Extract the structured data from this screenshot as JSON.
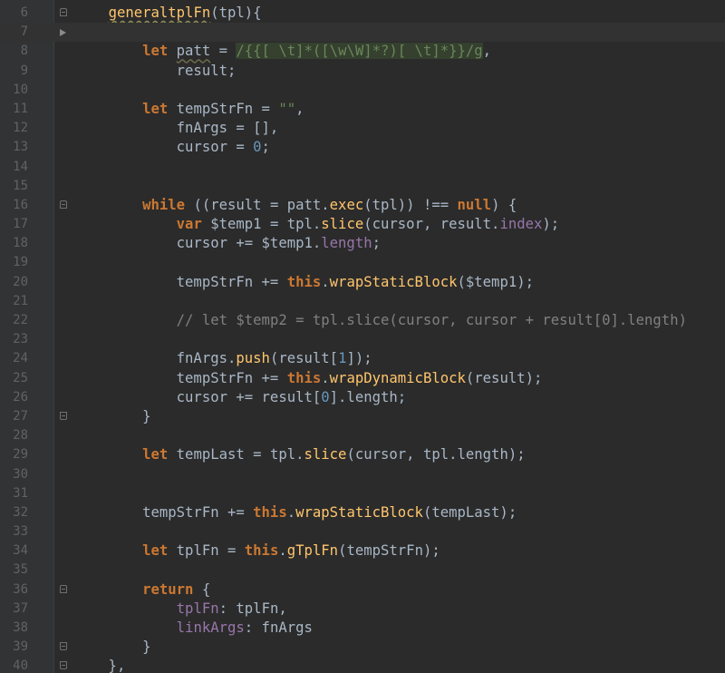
{
  "editor": {
    "lines": [
      {
        "n": "6",
        "fold": "open",
        "tokens": [
          {
            "t": "    "
          },
          {
            "t": "generaltplFn",
            "c": "fnu"
          },
          {
            "t": "(tpl){"
          }
        ]
      },
      {
        "n": "7",
        "current": true,
        "arrow": true,
        "tokens": []
      },
      {
        "n": "8",
        "tokens": [
          {
            "t": "        "
          },
          {
            "t": "let",
            "c": "kw"
          },
          {
            "t": " "
          },
          {
            "t": "patt",
            "c": "vwav"
          },
          {
            "t": " = "
          },
          {
            "t": "/{{[ \\t]*([\\w\\W]*?)[ \\t]*}}/g",
            "c": "rx"
          },
          {
            "t": ","
          }
        ]
      },
      {
        "n": "9",
        "tokens": [
          {
            "t": "            result;"
          }
        ]
      },
      {
        "n": "10",
        "tokens": []
      },
      {
        "n": "11",
        "tokens": [
          {
            "t": "        "
          },
          {
            "t": "let",
            "c": "kw"
          },
          {
            "t": " tempStrFn = "
          },
          {
            "t": "\"\"",
            "c": "str"
          },
          {
            "t": ","
          }
        ]
      },
      {
        "n": "12",
        "tokens": [
          {
            "t": "            fnArgs = [],"
          }
        ]
      },
      {
        "n": "13",
        "tokens": [
          {
            "t": "            cursor = "
          },
          {
            "t": "0",
            "c": "num"
          },
          {
            "t": ";"
          }
        ]
      },
      {
        "n": "14",
        "tokens": []
      },
      {
        "n": "15",
        "tokens": []
      },
      {
        "n": "16",
        "fold": "open",
        "tokens": [
          {
            "t": "        "
          },
          {
            "t": "while",
            "c": "kw"
          },
          {
            "t": " ((result = patt."
          },
          {
            "t": "exec",
            "c": "fn"
          },
          {
            "t": "(tpl)) !== "
          },
          {
            "t": "null",
            "c": "kw"
          },
          {
            "t": ") {"
          }
        ]
      },
      {
        "n": "17",
        "tokens": [
          {
            "t": "            "
          },
          {
            "t": "var",
            "c": "kw"
          },
          {
            "t": " $temp1 = tpl."
          },
          {
            "t": "slice",
            "c": "fn"
          },
          {
            "t": "(cursor, result."
          },
          {
            "t": "index",
            "c": "prop"
          },
          {
            "t": ");"
          }
        ]
      },
      {
        "n": "18",
        "tokens": [
          {
            "t": "            cursor += $temp1."
          },
          {
            "t": "length",
            "c": "prop"
          },
          {
            "t": ";"
          }
        ]
      },
      {
        "n": "19",
        "tokens": []
      },
      {
        "n": "20",
        "tokens": [
          {
            "t": "            tempStrFn += "
          },
          {
            "t": "this",
            "c": "kw"
          },
          {
            "t": "."
          },
          {
            "t": "wrapStaticBlock",
            "c": "fn"
          },
          {
            "t": "($temp1);"
          }
        ]
      },
      {
        "n": "21",
        "tokens": []
      },
      {
        "n": "22",
        "tokens": [
          {
            "t": "            "
          },
          {
            "t": "// let $temp2 = tpl.slice(cursor, cursor + result[0].length)",
            "c": "cmt"
          }
        ]
      },
      {
        "n": "23",
        "tokens": []
      },
      {
        "n": "24",
        "tokens": [
          {
            "t": "            fnArgs."
          },
          {
            "t": "push",
            "c": "fn"
          },
          {
            "t": "(result["
          },
          {
            "t": "1",
            "c": "num"
          },
          {
            "t": "]);"
          }
        ]
      },
      {
        "n": "25",
        "tokens": [
          {
            "t": "            tempStrFn += "
          },
          {
            "t": "this",
            "c": "kw"
          },
          {
            "t": "."
          },
          {
            "t": "wrapDynamicBlock",
            "c": "fn"
          },
          {
            "t": "(result);"
          }
        ]
      },
      {
        "n": "26",
        "tokens": [
          {
            "t": "            cursor += result["
          },
          {
            "t": "0",
            "c": "num"
          },
          {
            "t": "].length;"
          }
        ]
      },
      {
        "n": "27",
        "fold": "close",
        "tokens": [
          {
            "t": "        }"
          }
        ]
      },
      {
        "n": "28",
        "tokens": []
      },
      {
        "n": "29",
        "tokens": [
          {
            "t": "        "
          },
          {
            "t": "let",
            "c": "kw"
          },
          {
            "t": " tempLast = tpl."
          },
          {
            "t": "slice",
            "c": "fn"
          },
          {
            "t": "(cursor, tpl.length);"
          }
        ]
      },
      {
        "n": "30",
        "tokens": []
      },
      {
        "n": "31",
        "tokens": []
      },
      {
        "n": "32",
        "tokens": [
          {
            "t": "        tempStrFn += "
          },
          {
            "t": "this",
            "c": "kw"
          },
          {
            "t": "."
          },
          {
            "t": "wrapStaticBlock",
            "c": "fn"
          },
          {
            "t": "(tempLast);"
          }
        ]
      },
      {
        "n": "33",
        "tokens": []
      },
      {
        "n": "34",
        "tokens": [
          {
            "t": "        "
          },
          {
            "t": "let",
            "c": "kw"
          },
          {
            "t": " tplFn = "
          },
          {
            "t": "this",
            "c": "kw"
          },
          {
            "t": "."
          },
          {
            "t": "gTplFn",
            "c": "fn"
          },
          {
            "t": "(tempStrFn);"
          }
        ]
      },
      {
        "n": "35",
        "tokens": []
      },
      {
        "n": "36",
        "fold": "open",
        "tokens": [
          {
            "t": "        "
          },
          {
            "t": "return",
            "c": "kw"
          },
          {
            "t": " {"
          }
        ]
      },
      {
        "n": "37",
        "tokens": [
          {
            "t": "            "
          },
          {
            "t": "tplFn",
            "c": "prop"
          },
          {
            "t": ": tplFn,"
          }
        ]
      },
      {
        "n": "38",
        "tokens": [
          {
            "t": "            "
          },
          {
            "t": "linkArgs",
            "c": "prop"
          },
          {
            "t": ": fnArgs"
          }
        ]
      },
      {
        "n": "39",
        "fold": "close",
        "tokens": [
          {
            "t": "        }"
          }
        ]
      },
      {
        "n": "40",
        "fold": "close",
        "tokens": [
          {
            "t": "    },"
          }
        ]
      }
    ]
  }
}
